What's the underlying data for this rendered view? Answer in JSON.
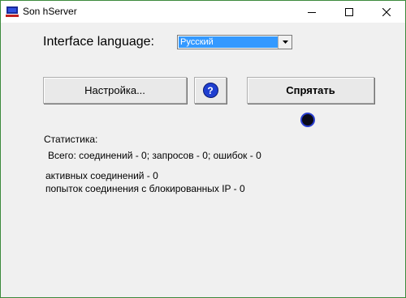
{
  "window": {
    "title": "Son hServer",
    "accent": "#3c8a3c"
  },
  "language": {
    "label": "Interface language:",
    "selected": "Русский"
  },
  "buttons": {
    "settings": "Настройка...",
    "help": "?",
    "hide": "Спрятать"
  },
  "stats": {
    "title": "Статистика:",
    "totals": "Всего: соединений - 0; запросов - 0; ошибок - 0",
    "active": "активных соединений - 0",
    "blocked": "попыток соединения с блокированных IP - 0"
  }
}
